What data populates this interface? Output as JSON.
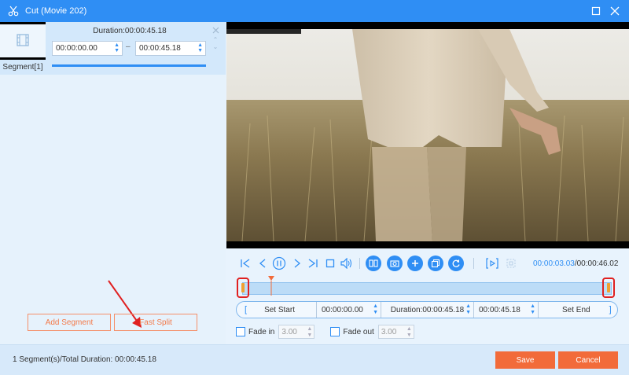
{
  "window": {
    "title": "Cut (Movie 202)",
    "titlebar_color": "#2f8ef4"
  },
  "segment": {
    "label": "Segment[1]",
    "duration": "Duration:00:00:45.18",
    "start": "00:00:00.00",
    "end": "00:00:45.18",
    "separator": "–"
  },
  "left_buttons": {
    "add_segment": "Add Segment",
    "fast_split": "Fast Split"
  },
  "playback": {
    "current_time": "00:00:03.03",
    "total_time": "/00:00:46.02",
    "icons": [
      "jump-start-icon",
      "prev-frame-icon",
      "pause-icon",
      "next-frame-icon",
      "jump-end-icon",
      "stop-icon",
      "volume-icon",
      "split-icon",
      "snapshot-icon",
      "add-icon",
      "copy-icon",
      "reset-icon",
      "preview-icon",
      "loop-icon"
    ]
  },
  "setbar": {
    "set_start": "Set Start",
    "start_value": "00:00:00.00",
    "duration": "Duration:00:00:45.18",
    "end_value": "00:00:45.18",
    "set_end": "Set End",
    "left_bracket": "[",
    "right_bracket": "]"
  },
  "fade": {
    "fade_in_label": "Fade in",
    "fade_in_value": "3.00",
    "fade_out_label": "Fade out",
    "fade_out_value": "3.00"
  },
  "footer": {
    "summary": "1 Segment(s)/Total Duration: 00:00:45.18",
    "save": "Save",
    "cancel": "Cancel"
  },
  "colors": {
    "accent": "#2f8ef4",
    "action": "#f26b3a",
    "highlight": "#e02020"
  }
}
